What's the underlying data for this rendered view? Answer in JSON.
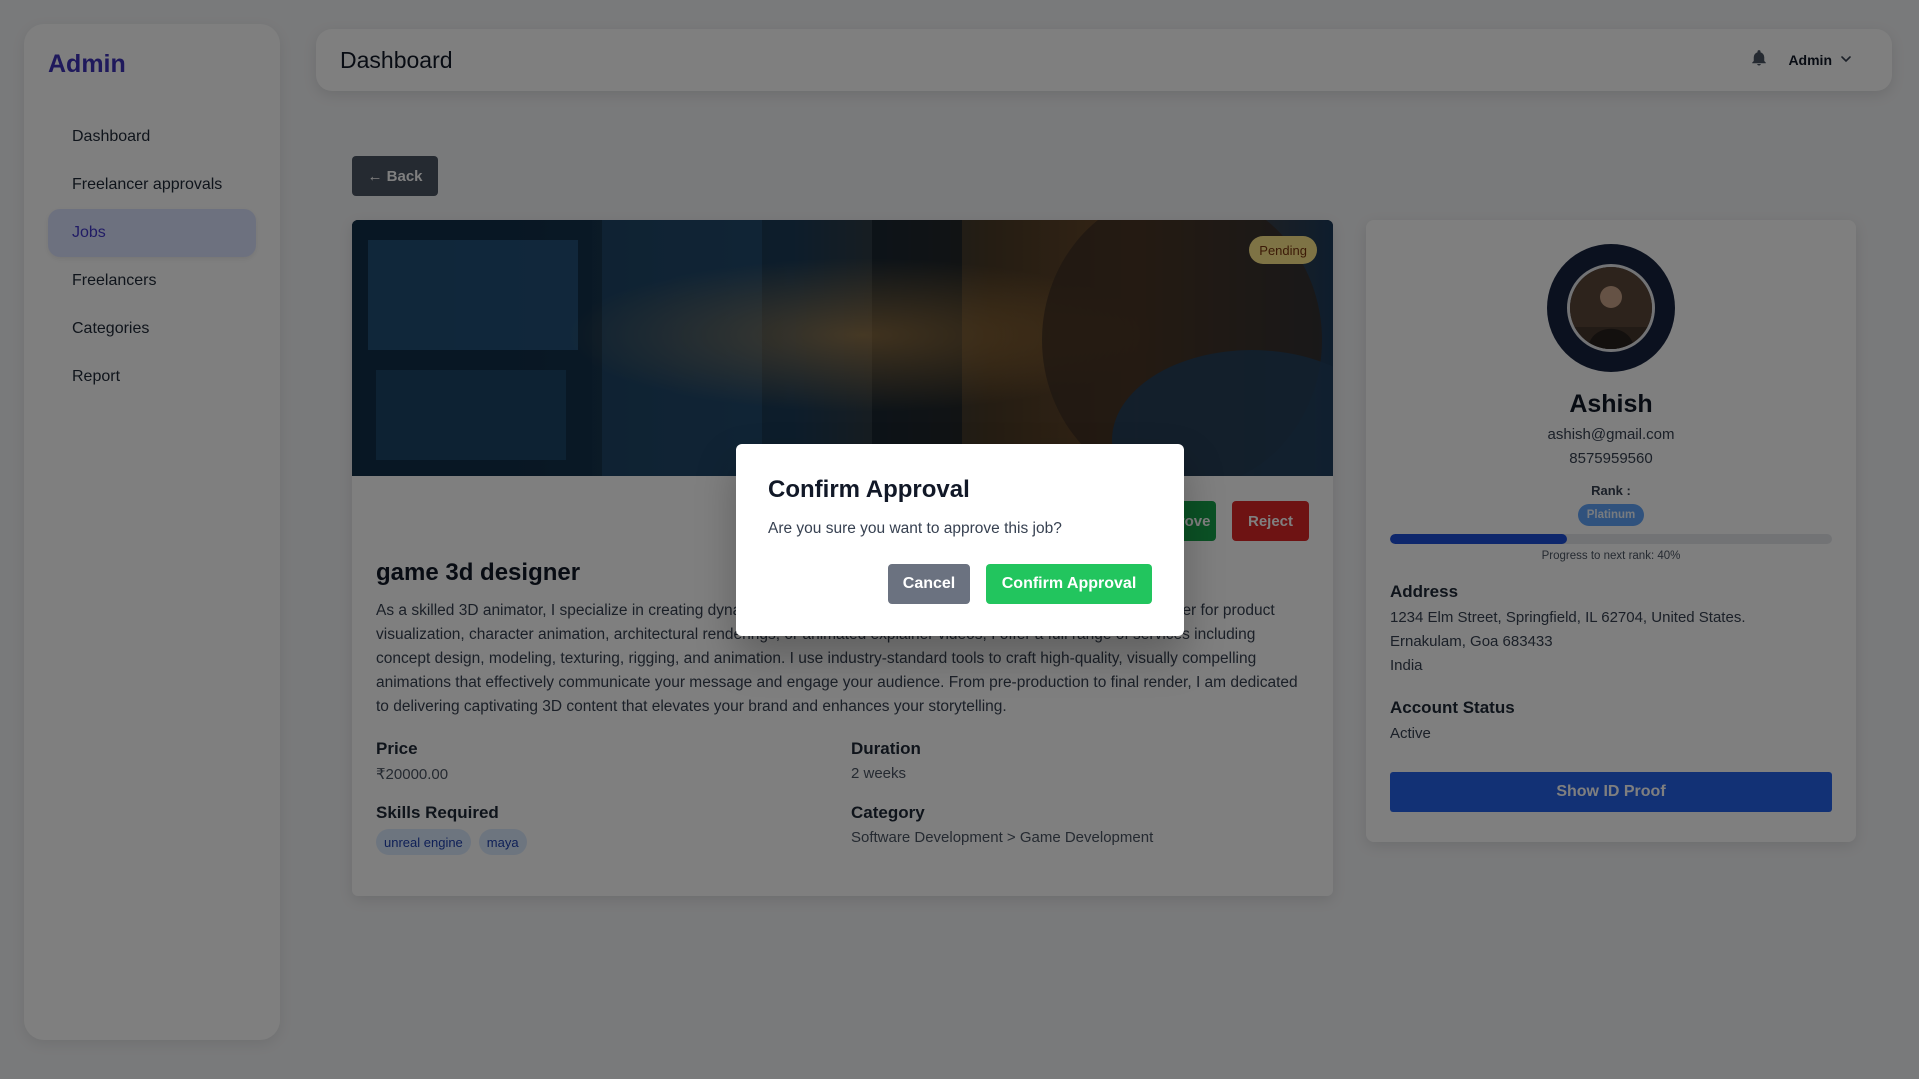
{
  "sidebar": {
    "brand": "Admin",
    "items": [
      {
        "label": "Dashboard"
      },
      {
        "label": "Freelancer approvals"
      },
      {
        "label": "Jobs"
      },
      {
        "label": "Freelancers"
      },
      {
        "label": "Categories"
      },
      {
        "label": "Report"
      }
    ],
    "active_item": "Jobs"
  },
  "header": {
    "title": "Dashboard",
    "user_menu_label": "Admin",
    "icons": [
      "bell-icon",
      "chevron-down-icon"
    ]
  },
  "back_button": {
    "label": "← Back"
  },
  "job": {
    "status_badge": "Pending",
    "approve_label": "Approve",
    "reject_label": "Reject",
    "title": "game 3d designer",
    "description": "As a skilled 3D animator, I specialize in creating dynamic and engaging animations that bring your ideas to life. Whether for product visualization, character animation, architectural renderings, or animated explainer videos, I offer a full range of services including concept design, modeling, texturing, rigging, and animation. I use industry-standard tools to craft high-quality, visually compelling animations that effectively communicate your message and engage your audience. From pre-production to final render, I am dedicated to delivering captivating 3D content that elevates your brand and enhances your storytelling.",
    "price_label": "Price",
    "price_value": "₹20000.00",
    "duration_label": "Duration",
    "duration_value": "2 weeks",
    "skills_label": "Skills Required",
    "skills": [
      "unreal engine",
      "maya"
    ],
    "category_label": "Category",
    "category_value": "Software Development > Game Development"
  },
  "profile": {
    "name": "Ashish",
    "email": "ashish@gmail.com",
    "phone": "8575959560",
    "rank_label": "Rank :",
    "rank_value": "Platinum",
    "progress_percent": 40,
    "progress_text": "Progress to next rank: 40%",
    "address_label": "Address",
    "address_lines": [
      "1234 Elm Street, Springfield, IL 62704, United States.",
      "Ernakulam, Goa 683433",
      "India"
    ],
    "account_status_label": "Account Status",
    "account_status_value": "Active",
    "id_proof_button": "Show ID Proof"
  },
  "modal": {
    "title": "Confirm Approval",
    "message": "Are you sure you want to approve this job?",
    "cancel_label": "Cancel",
    "confirm_label": "Confirm Approval"
  },
  "colors": {
    "brand": "#3f32b8",
    "active_nav_bg": "#dbe3ff",
    "approve": "#16a34a",
    "reject": "#dc2626",
    "primary": "#2563eb",
    "confirm": "#22c55e",
    "cancel": "#6b7280",
    "overlay": "rgba(0,0,0,0.5)"
  }
}
